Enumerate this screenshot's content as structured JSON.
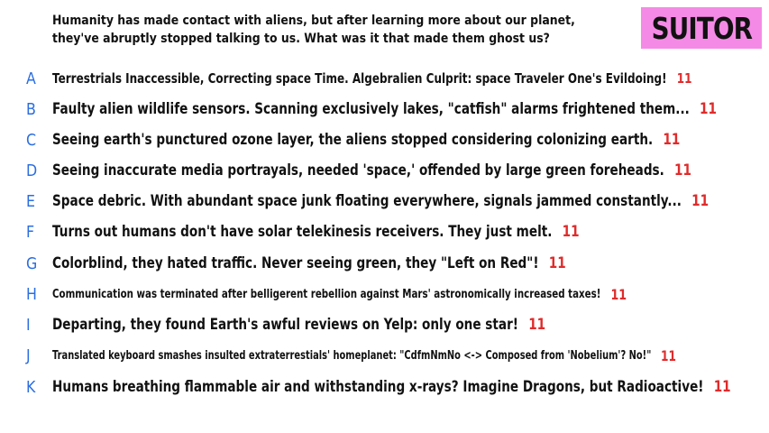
{
  "prompt": {
    "line1": "Humanity has made contact with aliens, but after learning more about our planet,",
    "line2": "they've abruptly stopped talking to us. What was it that made them ghost us?"
  },
  "tag": "SUITOR",
  "answers": [
    {
      "letter": "A",
      "text": "Terrestrials Inaccessible, Correcting space Time. Algebralien Culprit: space Traveler One's Evildoing!",
      "score": "11"
    },
    {
      "letter": "B",
      "text": "Faulty alien wildlife sensors. Scanning exclusively lakes, \"catfish\" alarms frightened them...",
      "score": "11"
    },
    {
      "letter": "C",
      "text": "Seeing earth's punctured ozone layer, the aliens stopped considering colonizing earth.",
      "score": "11"
    },
    {
      "letter": "D",
      "text": "Seeing inaccurate media portrayals, needed 'space,' offended by large green foreheads.",
      "score": "11"
    },
    {
      "letter": "E",
      "text": "Space debric. With abundant space junk floating everywhere, signals jammed constantly...",
      "score": "11"
    },
    {
      "letter": "F",
      "text": "Turns out humans don't have solar telekinesis receivers. They just melt.",
      "score": "11"
    },
    {
      "letter": "G",
      "text": "Colorblind, they hated traffic. Never seeing green, they \"Left on Red\"!",
      "score": "11"
    },
    {
      "letter": "H",
      "text": "Communication was terminated after belligerent rebellion against Mars' astronomically increased taxes!",
      "score": "11"
    },
    {
      "letter": "I",
      "text": "Departing, they found Earth's awful reviews on Yelp: only one star!",
      "score": "11"
    },
    {
      "letter": "J",
      "text": "Translated keyboard smashes insulted extraterrestials' homeplanet: \"CdfmNmNo <-> Composed from 'Nobelium'? No!\"",
      "score": "11"
    },
    {
      "letter": "K",
      "text": "Humans breathing flammable air and withstanding x-rays? Imagine Dragons, but Radioactive!",
      "score": "11"
    }
  ],
  "colors": {
    "letter": "#2b6ee0",
    "score": "#e02b2b",
    "tag_bg": "#f58ae6"
  }
}
